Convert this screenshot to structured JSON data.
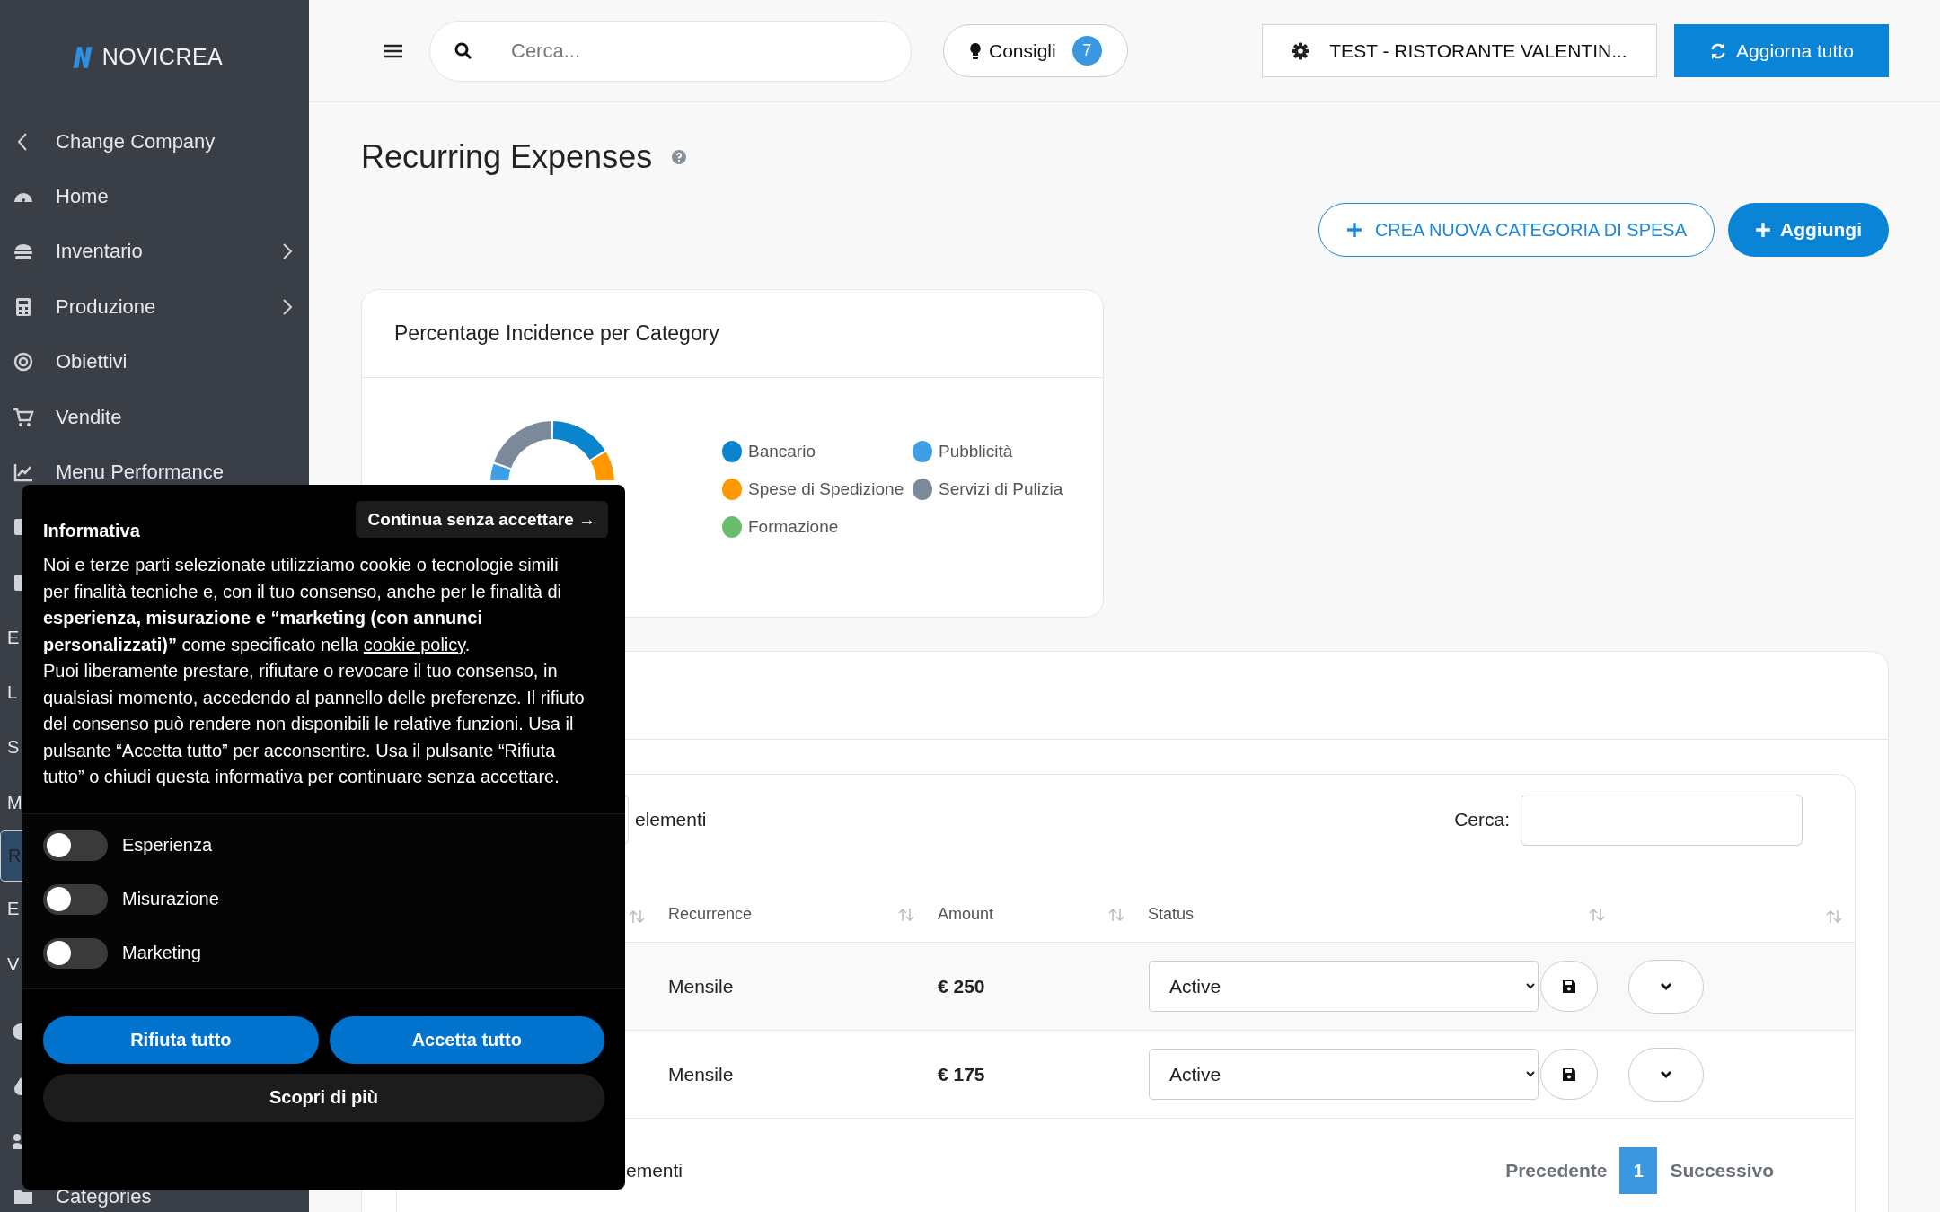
{
  "sidebar": {
    "logo": "NOVICREA",
    "items": [
      {
        "label": "Change Company",
        "kind": "back",
        "selected": false
      },
      {
        "label": "Home",
        "kind": "link",
        "selected": false
      },
      {
        "label": "Inventario",
        "kind": "group",
        "selected": false
      },
      {
        "label": "Produzione",
        "kind": "group",
        "selected": false
      },
      {
        "label": "Obiettivi",
        "kind": "link",
        "selected": false
      },
      {
        "label": "Vendite",
        "kind": "link",
        "selected": false
      },
      {
        "label": "Menu Performance",
        "kind": "link",
        "selected": false
      },
      {
        "kind": "link",
        "selected": false
      },
      {
        "kind": "link",
        "selected": false
      },
      {
        "label": "E",
        "kind": "heading",
        "selected": false
      },
      {
        "label": "L",
        "kind": "heading",
        "selected": false
      },
      {
        "label": "S",
        "kind": "heading",
        "selected": false
      },
      {
        "label": "M",
        "kind": "heading",
        "selected": false
      },
      {
        "label": "R",
        "kind": "heading",
        "selected": true
      },
      {
        "label": "E",
        "kind": "heading",
        "selected": false
      },
      {
        "label": "V",
        "kind": "heading",
        "selected": false
      },
      {
        "kind": "link",
        "selected": false
      },
      {
        "kind": "link",
        "selected": false
      },
      {
        "kind": "link",
        "selected": false
      },
      {
        "label": "Categories",
        "kind": "link",
        "selected": false
      }
    ]
  },
  "header": {
    "search": {
      "placeholder": "Cerca..."
    },
    "tips": {
      "label": "Consigli",
      "count": "7"
    },
    "company": "TEST - RISTORANTE VALENTIN...",
    "refresh": "Aggiorna tutto"
  },
  "page": {
    "title": "Recurring Expenses",
    "actions": [
      "CREA NUOVA CATEGORIA DI SPESA",
      "Aggiungi"
    ]
  },
  "chart_card": {
    "title": "Percentage Incidence per Category",
    "legend": [
      {
        "label": "Bancario",
        "color": "#0a84cc"
      },
      {
        "label": "Pubblicità",
        "color": "#3f9fe6"
      },
      {
        "label": "Spese di Spedizione",
        "color": "#ff9800"
      },
      {
        "label": "Servizi di Pulizia",
        "color": "#7b8a9a"
      },
      {
        "label": "Formazione",
        "color": "#6bbd6e"
      }
    ]
  },
  "table": {
    "length_suffix": "elementi",
    "search_label": "Cerca:",
    "columns": [
      "",
      "Recurrence",
      "Amount",
      "Status",
      ""
    ],
    "rows": [
      {
        "recurrence": "Mensile",
        "amount": "€ 250",
        "status": "Active"
      },
      {
        "recurrence": "Mensile",
        "amount": "€ 175",
        "status": "Active"
      }
    ],
    "info": "ementi",
    "pagination": {
      "previous": "Precedente",
      "pages": [
        {
          "label": "1",
          "selected": true
        }
      ],
      "next": "Successivo"
    }
  },
  "cookie_banner": {
    "title": "Informativa",
    "continue": "Continua senza accettare →",
    "text_before": "Noi e terze parti selezionate utilizziamo cookie o tecnologie simili per finalità tecniche e, con il tuo consenso, anche per le finalità di **esperienza, misurazione e “marketing (con annunci personalizzati)”** come specificato nella",
    "link": "cookie policy",
    "text_after": ".",
    "text_2": "Puoi liberamente prestare, rifiutare o revocare il tuo consenso, in qualsiasi momento, accedendo al pannello delle preferenze. Il rifiuto del consenso può rendere non disponibili le relative funzioni. Usa il pulsante “Accetta tutto” per acconsentire. Usa il pulsante “Rifiuta tutto” o chiudi questa informativa per continuare senza accettare.",
    "toggles": [
      {
        "label": "Esperienza",
        "on": false
      },
      {
        "label": "Misurazione",
        "on": false
      },
      {
        "label": "Marketing",
        "on": false
      }
    ],
    "buttons": [
      {
        "label": "Rifiuta tutto",
        "kind": "primary"
      },
      {
        "label": "Accetta tutto",
        "kind": "primary"
      },
      {
        "label": "Scopri di più",
        "kind": "secondary"
      }
    ]
  }
}
